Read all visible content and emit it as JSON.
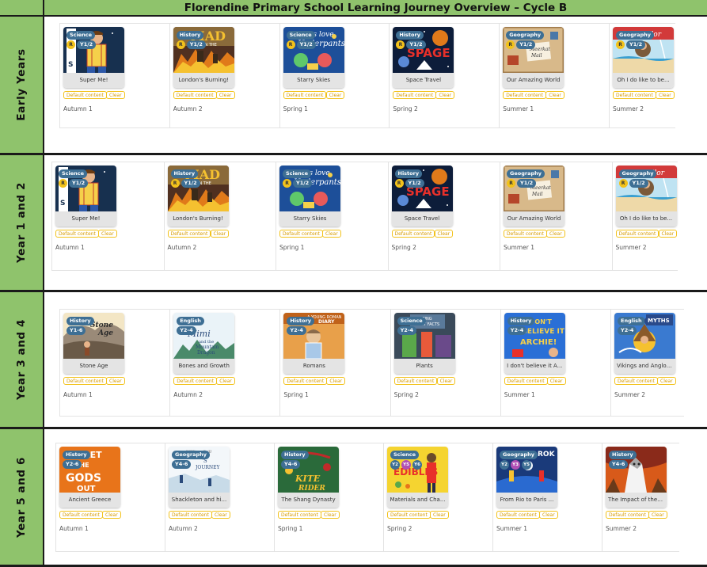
{
  "title": "Florendine Primary School Learning Journey Overview – Cycle B",
  "labels": {
    "default": "Default content",
    "clear": "Clear"
  },
  "rows": [
    {
      "name": "Early Years",
      "cards": [
        {
          "subject": "Science",
          "year": "Y1/2",
          "title": "Super Me!",
          "term": "Autumn 1",
          "img": "superme"
        },
        {
          "subject": "History",
          "year": "Y1/2",
          "title": "London's Burning!",
          "term": "Autumn 2",
          "img": "fire"
        },
        {
          "subject": "Science",
          "year": "Y1/2",
          "title": "Starry Skies",
          "term": "Spring 1",
          "img": "aliens"
        },
        {
          "subject": "History",
          "year": "Y1/2",
          "title": "Space Travel",
          "term": "Spring 2",
          "img": "space"
        },
        {
          "subject": "Geography",
          "year": "Y1/2",
          "title": "Our Amazing World",
          "term": "Summer 1",
          "img": "meerkat"
        },
        {
          "subject": "Geography",
          "year": "Y1/2",
          "title": "Oh I do like to be...",
          "term": "Summer 2",
          "img": "seaside"
        }
      ]
    },
    {
      "name": "Year 1 and 2",
      "cards": [
        {
          "subject": "Science",
          "year": "Y1/2",
          "title": "Super Me!",
          "term": "Autumn 1",
          "img": "superme"
        },
        {
          "subject": "History",
          "year": "Y1/2",
          "title": "London's Burning!",
          "term": "Autumn 2",
          "img": "fire"
        },
        {
          "subject": "Science",
          "year": "Y1/2",
          "title": "Starry Skies",
          "term": "Spring 1",
          "img": "aliens"
        },
        {
          "subject": "History",
          "year": "Y1/2",
          "title": "Space Travel",
          "term": "Spring 2",
          "img": "space"
        },
        {
          "subject": "Geography",
          "year": "Y1/2",
          "title": "Our Amazing World",
          "term": "Summer 1",
          "img": "meerkat"
        },
        {
          "subject": "Geography",
          "year": "Y1/2",
          "title": "Oh I do like to be...",
          "term": "Summer 2",
          "img": "seaside"
        }
      ]
    },
    {
      "name": "Year 3 and 4",
      "cards": [
        {
          "subject": "History",
          "year": "Y1-6",
          "title": "Stone Age",
          "term": "Autumn 1",
          "img": "stoneage"
        },
        {
          "subject": "English",
          "year": "Y2-4",
          "title": "Bones and Growth",
          "term": "Autumn 2",
          "img": "mimi"
        },
        {
          "subject": "History",
          "year": "Y2-4",
          "title": "Romans",
          "term": "Spring 1",
          "img": "romans"
        },
        {
          "subject": "Science",
          "year": "Y2-4",
          "title": "Plants",
          "term": "Spring 2",
          "img": "plants"
        },
        {
          "subject": "History",
          "year": "Y2-4",
          "title": "I don't believe it A...",
          "term": "Summer 1",
          "img": "believe"
        },
        {
          "subject": "English",
          "year": "Y2-4",
          "title": "Vikings and Anglo ...",
          "term": "Summer 2",
          "img": "myths",
          "extra": "MYTHS"
        }
      ]
    },
    {
      "name": "Year 5 and 6",
      "cards": [
        {
          "subject": "History",
          "year": "Y2-6",
          "title": "Ancient Greece",
          "term": "Autumn 1",
          "img": "greece"
        },
        {
          "subject": "Geography",
          "year": "Y4-6",
          "title": "Shackleton and hi...",
          "term": "Autumn 2",
          "img": "shackleton"
        },
        {
          "subject": "History",
          "year": "Y4-6",
          "title": "The Shang Dynasty",
          "term": "Spring 1",
          "img": "kite"
        },
        {
          "subject": "Science",
          "years": [
            "Y2",
            "Y5",
            "Y6"
          ],
          "title": "Materials and Cha...",
          "term": "Spring 2",
          "img": "edibles"
        },
        {
          "subject": "Geography",
          "years": [
            "Y2",
            "Y3",
            "Y5"
          ],
          "title": "From Rio to Paris ...",
          "term": "Summer 1",
          "img": "rio"
        },
        {
          "subject": "History",
          "year": "Y4-6",
          "title": "The Impact of the ...",
          "term": "Summer 2",
          "img": "impact"
        }
      ]
    }
  ],
  "colors": {
    "green": "#8fc36c",
    "badge": "#3e6f94",
    "yellow": "#f2c21b",
    "purple": "#b04fb4"
  }
}
